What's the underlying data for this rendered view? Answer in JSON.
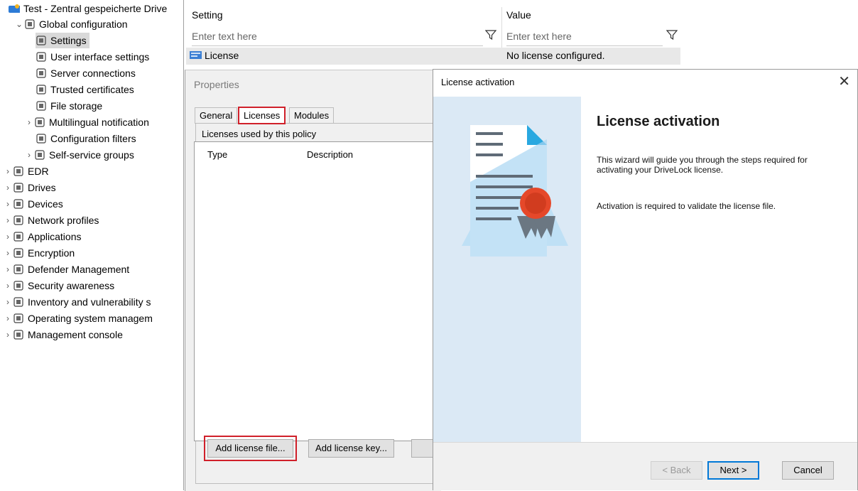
{
  "tree": {
    "root_label": "Test - Zentral gespeicherte Drive",
    "items": [
      {
        "label": "Global configuration",
        "icon": "gear-group-icon",
        "arrow": "expanded"
      },
      {
        "label": "Settings",
        "icon": "settings-icon",
        "arrow": "none",
        "selected": true
      },
      {
        "label": "User interface settings",
        "icon": "ui-settings-icon",
        "arrow": "none"
      },
      {
        "label": "Server connections",
        "icon": "server-icon",
        "arrow": "none"
      },
      {
        "label": "Trusted certificates",
        "icon": "certificate-icon",
        "arrow": "none"
      },
      {
        "label": "File storage",
        "icon": "file-storage-icon",
        "arrow": "none"
      },
      {
        "label": "Multilingual notification",
        "icon": "notification-icon",
        "arrow": "collapsed"
      },
      {
        "label": "Configuration filters",
        "icon": "filter-icon",
        "arrow": "none"
      },
      {
        "label": "Self-service groups",
        "icon": "group-icon",
        "arrow": "collapsed"
      },
      {
        "label": "EDR",
        "icon": "edr-icon",
        "arrow": "collapsed"
      },
      {
        "label": "Drives",
        "icon": "drive-icon",
        "arrow": "collapsed"
      },
      {
        "label": "Devices",
        "icon": "device-icon",
        "arrow": "collapsed"
      },
      {
        "label": "Network profiles",
        "icon": "network-icon",
        "arrow": "collapsed"
      },
      {
        "label": "Applications",
        "icon": "application-icon",
        "arrow": "collapsed"
      },
      {
        "label": "Encryption",
        "icon": "lock-icon",
        "arrow": "collapsed"
      },
      {
        "label": "Defender Management",
        "icon": "shield-icon",
        "arrow": "collapsed"
      },
      {
        "label": "Security awareness",
        "icon": "awareness-icon",
        "arrow": "collapsed"
      },
      {
        "label": "Inventory and vulnerability s",
        "icon": "inventory-icon",
        "arrow": "collapsed"
      },
      {
        "label": "Operating system managem",
        "icon": "monitor-icon",
        "arrow": "collapsed"
      },
      {
        "label": "Management console",
        "icon": "console-icon",
        "arrow": "collapsed"
      }
    ]
  },
  "grid": {
    "col_setting": "Setting",
    "col_value": "Value",
    "filter_placeholder_setting": "Enter text here",
    "filter_placeholder_value": "Enter text here",
    "row_setting": "License",
    "row_value": "No license configured."
  },
  "properties": {
    "title": "Properties",
    "tabs": [
      "General",
      "Licenses",
      "Modules"
    ],
    "active_tab": "Licenses",
    "group_label": "Licenses used by this policy",
    "columns": [
      "Type",
      "Description"
    ],
    "buttons": {
      "add_file": "Add license file...",
      "add_key": "Add license key..."
    }
  },
  "wizard": {
    "window_title": "License activation",
    "heading": "License activation",
    "text1": "This wizard will guide you through the steps required for activating your DriveLock license.",
    "text2": "Activation is required to validate the license file.",
    "buttons": {
      "back": "< Back",
      "next": "Next >",
      "cancel": "Cancel"
    },
    "close_glyph": "✕"
  },
  "colors": {
    "highlight": "#d0202a",
    "accent": "#0078d7",
    "art_bg": "#dbe9f5"
  }
}
